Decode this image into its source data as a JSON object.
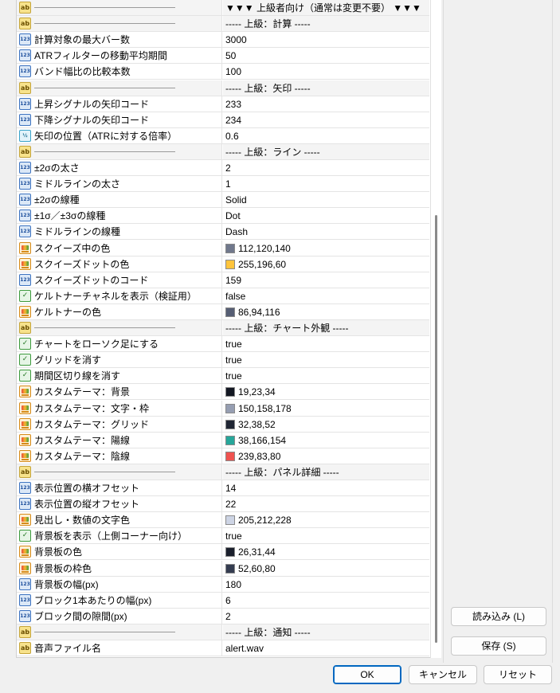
{
  "rows": [
    {
      "type": "sep",
      "icon": "ab",
      "value": "▼▼▼ 上級者向け（通常は変更不要） ▼▼▼"
    },
    {
      "type": "sep",
      "icon": "ab",
      "value": "----- 上級：計算 -----"
    },
    {
      "type": "prop",
      "icon": "num",
      "name": "計算対象の最大バー数",
      "value": "3000"
    },
    {
      "type": "prop",
      "icon": "num",
      "name": "ATRフィルターの移動平均期間",
      "value": "50"
    },
    {
      "type": "prop",
      "icon": "num",
      "name": "バンド幅比の比較本数",
      "value": "100"
    },
    {
      "type": "sep",
      "icon": "ab",
      "value": "----- 上級：矢印 -----"
    },
    {
      "type": "prop",
      "icon": "num",
      "name": "上昇シグナルの矢印コード",
      "value": "233"
    },
    {
      "type": "prop",
      "icon": "num",
      "name": "下降シグナルの矢印コード",
      "value": "234"
    },
    {
      "type": "prop",
      "icon": "dbl",
      "name": "矢印の位置（ATRに対する倍率）",
      "value": "0.6"
    },
    {
      "type": "sep",
      "icon": "ab",
      "value": "----- 上級：ライン -----"
    },
    {
      "type": "prop",
      "icon": "num",
      "name": "±2σの太さ",
      "value": "2"
    },
    {
      "type": "prop",
      "icon": "num",
      "name": "ミドルラインの太さ",
      "value": "1"
    },
    {
      "type": "prop",
      "icon": "num",
      "name": "±2σの線種",
      "value": "Solid"
    },
    {
      "type": "prop",
      "icon": "num",
      "name": "±1σ／±3σの線種",
      "value": "Dot"
    },
    {
      "type": "prop",
      "icon": "num",
      "name": "ミドルラインの線種",
      "value": "Dash"
    },
    {
      "type": "prop",
      "icon": "color",
      "name": "スクイーズ中の色",
      "value": "112,120,140",
      "swatch": "#70788c"
    },
    {
      "type": "prop",
      "icon": "color",
      "name": "スクイーズドットの色",
      "value": "255,196,60",
      "swatch": "#ffc43c"
    },
    {
      "type": "prop",
      "icon": "num",
      "name": "スクイーズドットのコード",
      "value": "159"
    },
    {
      "type": "prop",
      "icon": "bool",
      "name": "ケルトナーチャネルを表示（検証用）",
      "value": "false"
    },
    {
      "type": "prop",
      "icon": "color",
      "name": "ケルトナーの色",
      "value": "86,94,116",
      "swatch": "#565e74"
    },
    {
      "type": "sep",
      "icon": "ab",
      "value": "----- 上級：チャート外観 -----"
    },
    {
      "type": "prop",
      "icon": "bool",
      "name": "チャートをローソク足にする",
      "value": "true"
    },
    {
      "type": "prop",
      "icon": "bool",
      "name": "グリッドを消す",
      "value": "true"
    },
    {
      "type": "prop",
      "icon": "bool",
      "name": "期間区切り線を消す",
      "value": "true"
    },
    {
      "type": "prop",
      "icon": "color",
      "name": "カスタムテーマ：背景",
      "value": "19,23,34",
      "swatch": "#131722"
    },
    {
      "type": "prop",
      "icon": "color",
      "name": "カスタムテーマ：文字・枠",
      "value": "150,158,178",
      "swatch": "#969eb2"
    },
    {
      "type": "prop",
      "icon": "color",
      "name": "カスタムテーマ：グリッド",
      "value": "32,38,52",
      "swatch": "#202634"
    },
    {
      "type": "prop",
      "icon": "color",
      "name": "カスタムテーマ：陽線",
      "value": "38,166,154",
      "swatch": "#26a69a"
    },
    {
      "type": "prop",
      "icon": "color",
      "name": "カスタムテーマ：陰線",
      "value": "239,83,80",
      "swatch": "#ef5350"
    },
    {
      "type": "sep",
      "icon": "ab",
      "value": "----- 上級：パネル詳細 -----"
    },
    {
      "type": "prop",
      "icon": "num",
      "name": "表示位置の横オフセット",
      "value": "14"
    },
    {
      "type": "prop",
      "icon": "num",
      "name": "表示位置の縦オフセット",
      "value": "22"
    },
    {
      "type": "prop",
      "icon": "color",
      "name": "見出し・数値の文字色",
      "value": "205,212,228",
      "swatch": "#cdd4e4"
    },
    {
      "type": "prop",
      "icon": "bool",
      "name": "背景板を表示（上側コーナー向け）",
      "value": "true"
    },
    {
      "type": "prop",
      "icon": "color",
      "name": "背景板の色",
      "value": "26,31,44",
      "swatch": "#1a1f2c"
    },
    {
      "type": "prop",
      "icon": "color",
      "name": "背景板の枠色",
      "value": "52,60,80",
      "swatch": "#343c50"
    },
    {
      "type": "prop",
      "icon": "num",
      "name": "背景板の幅(px)",
      "value": "180"
    },
    {
      "type": "prop",
      "icon": "num",
      "name": "ブロック1本あたりの幅(px)",
      "value": "6"
    },
    {
      "type": "prop",
      "icon": "num",
      "name": "ブロック間の隙間(px)",
      "value": "2"
    },
    {
      "type": "sep",
      "icon": "ab",
      "value": "----- 上級：通知 -----"
    },
    {
      "type": "prop",
      "icon": "ab",
      "name": "音声ファイル名",
      "value": "alert.wav"
    }
  ],
  "buttons": {
    "load": "読み込み (L)",
    "save": "保存 (S)",
    "ok": "OK",
    "cancel": "キャンセル",
    "reset": "リセット"
  }
}
